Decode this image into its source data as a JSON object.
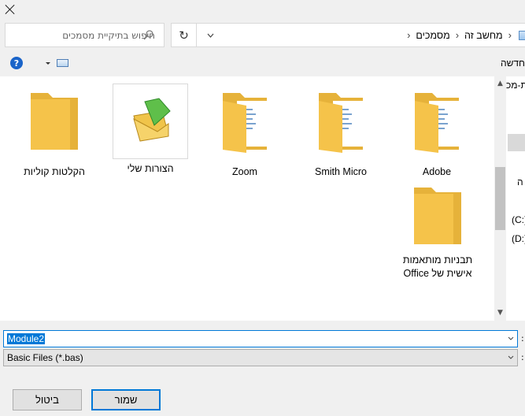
{
  "search": {
    "placeholder": "חיפוש בתיקיית מסמכים"
  },
  "breadcrumb": {
    "items": [
      "מחשב זה",
      "מסמכים"
    ]
  },
  "toolbar": {
    "new_folder_label": "חדשה"
  },
  "files": [
    {
      "label": "Adobe",
      "icon": "folder-docs-icon"
    },
    {
      "label": "Smith Micro",
      "icon": "folder-docs-icon"
    },
    {
      "label": "Zoom",
      "icon": "folder-docs-icon"
    },
    {
      "label": "הצורות שלי",
      "icon": "my-shapes-icon"
    },
    {
      "label": "הקלטות קוליות",
      "icon": "folder-icon"
    },
    {
      "label": "תבניות מותאמות אישית של Office",
      "icon": "folder-icon"
    }
  ],
  "nav_pane": {
    "items": [
      "ת-מכ",
      "ה",
      "(C:)",
      "(D:)"
    ]
  },
  "filename": {
    "value": "Module2"
  },
  "filetype": {
    "value": "Basic Files (*.bas)"
  },
  "buttons": {
    "save_label": "שמור",
    "cancel_label": "ביטול"
  },
  "colors": {
    "accent": "#0078d7",
    "folder": "#f5c34a",
    "help": "#1a64c9"
  }
}
